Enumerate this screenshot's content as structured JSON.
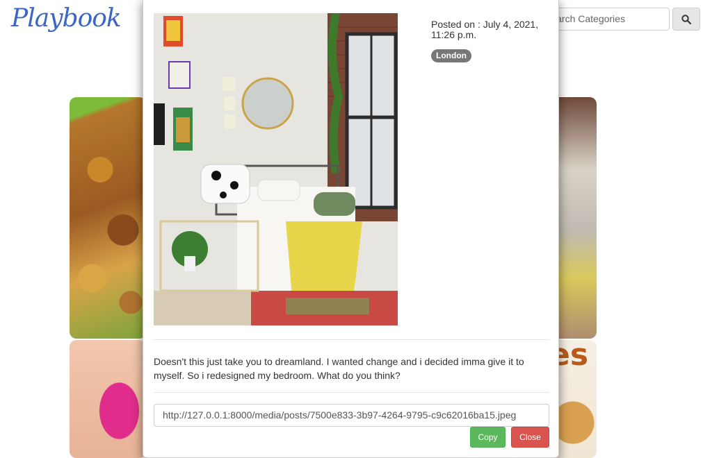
{
  "brand": {
    "name": "Playbook"
  },
  "search": {
    "placeholder": "Search Categories",
    "icon": "search-icon"
  },
  "background": {
    "tiles": [
      {
        "name": "food-tile"
      },
      {
        "name": "room-tile"
      },
      {
        "name": "nails-tile"
      },
      {
        "name": "cookies-tile",
        "text": "es"
      }
    ]
  },
  "modal": {
    "posted_on": "Posted on : July 4, 2021, 11:26 p.m.",
    "location_badge": "London",
    "description": "Doesn't this just take you to dreamland. I wanted change and i decided imma give it to myself. So i redesigned my bedroom. What do you think?",
    "image_url": "http://127.0.0.1:8000/media/posts/7500e833-3b97-4264-9795-c9c62016ba15.jpeg",
    "copy_label": "Copy",
    "close_label": "Close"
  },
  "colors": {
    "brand": "#3b66c4",
    "badge": "#777777",
    "copy_button": "#5cb85c",
    "close_button": "#d9534f"
  }
}
